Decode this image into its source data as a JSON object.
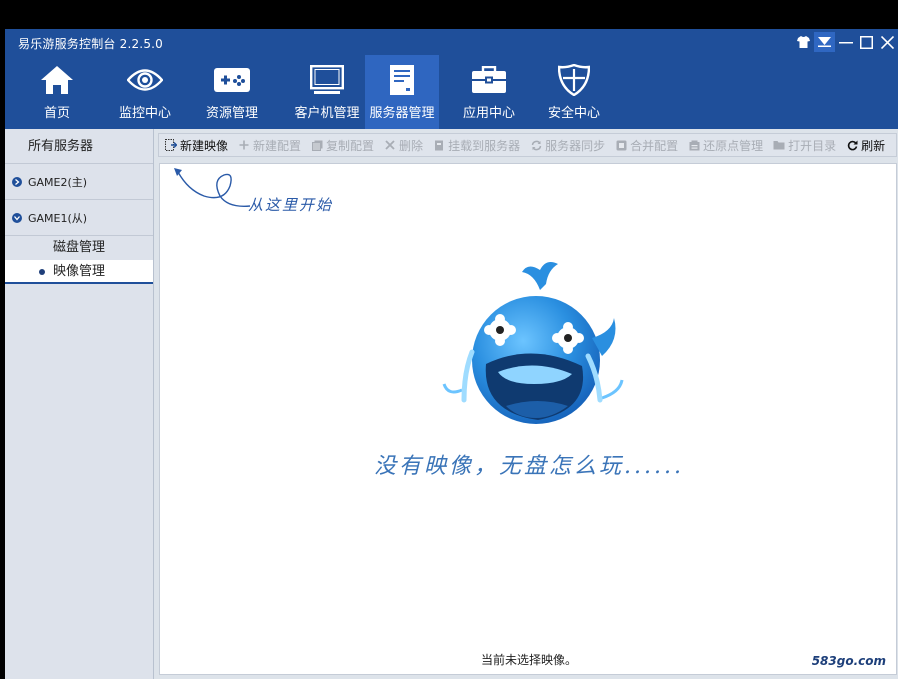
{
  "window": {
    "title": "易乐游服务控制台 2.2.5.0"
  },
  "nav": {
    "items": [
      {
        "label": "首页",
        "icon": "home-icon"
      },
      {
        "label": "监控中心",
        "icon": "eye-icon"
      },
      {
        "label": "资源管理",
        "icon": "gamepad-icon"
      },
      {
        "label": "客户机管理",
        "icon": "monitor-icon"
      },
      {
        "label": "服务器管理",
        "icon": "server-icon",
        "active": true
      },
      {
        "label": "应用中心",
        "icon": "toolbox-icon"
      },
      {
        "label": "安全中心",
        "icon": "shield-icon"
      }
    ]
  },
  "sidebar": {
    "header": "所有服务器",
    "groups": [
      {
        "label": "GAME2(主)"
      },
      {
        "label": "GAME1(从)"
      }
    ],
    "subitems": [
      {
        "label": "磁盘管理",
        "selected": false
      },
      {
        "label": "映像管理",
        "selected": true
      }
    ]
  },
  "toolbar": {
    "buttons": [
      {
        "label": "新建映像",
        "enabled": true
      },
      {
        "label": "新建配置",
        "enabled": false
      },
      {
        "label": "复制配置",
        "enabled": false
      },
      {
        "label": "删除",
        "enabled": false
      },
      {
        "label": "挂载到服务器",
        "enabled": false
      },
      {
        "label": "服务器同步",
        "enabled": false
      },
      {
        "label": "合并配置",
        "enabled": false
      },
      {
        "label": "还原点管理",
        "enabled": false
      },
      {
        "label": "打开目录",
        "enabled": false
      },
      {
        "label": "刷新",
        "enabled": true
      }
    ]
  },
  "content": {
    "hint": "从这里开始",
    "empty_message": "没有映像，无盘怎么玩......",
    "status": "当前未选择映像。"
  },
  "watermark": "583go.com",
  "colors": {
    "brand_blue": "#1f4f9a",
    "active_nav": "#2f66c0",
    "mascot_blue": "#2a8fe0"
  }
}
